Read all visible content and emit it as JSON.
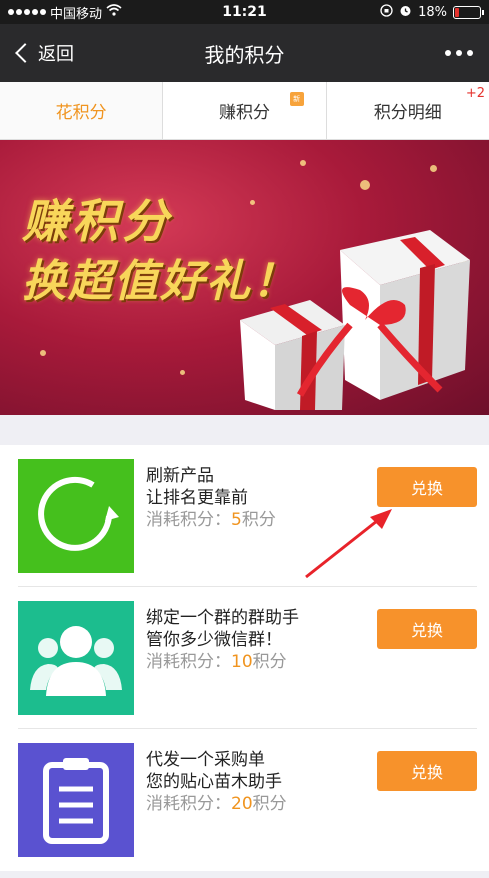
{
  "status": {
    "carrier": "中国移动",
    "time": "11:21",
    "battery": "18%",
    "battery_level": 0.18
  },
  "nav": {
    "back_label": "返回",
    "title": "我的积分"
  },
  "tabs": [
    {
      "label": "花积分",
      "active": true
    },
    {
      "label": "赚积分",
      "badge": "新"
    },
    {
      "label": "积分明细",
      "badge_count": "+2"
    }
  ],
  "banner": {
    "line1": "赚积分",
    "line2": "换超值好礼！"
  },
  "items": [
    {
      "line1": "刷新产品",
      "line2": "让排名更靠前",
      "cost_label": "消耗积分：",
      "cost_value": "5",
      "cost_unit": "积分",
      "button": "兑换",
      "icon": "refresh-icon"
    },
    {
      "line1": "绑定一个群的群助手",
      "line2": "管你多少微信群！",
      "cost_label": "消耗积分：",
      "cost_value": "10",
      "cost_unit": "积分",
      "button": "兑换",
      "icon": "group-icon"
    },
    {
      "line1": "代发一个采购单",
      "line2": "您的贴心苗木助手",
      "cost_label": "消耗积分：",
      "cost_value": "20",
      "cost_unit": "积分",
      "button": "兑换",
      "icon": "clipboard-icon"
    }
  ],
  "colors": {
    "accent": "#f7922b",
    "green": "#45c01d",
    "teal": "#1cbd8e",
    "purple": "#5a52d0"
  }
}
